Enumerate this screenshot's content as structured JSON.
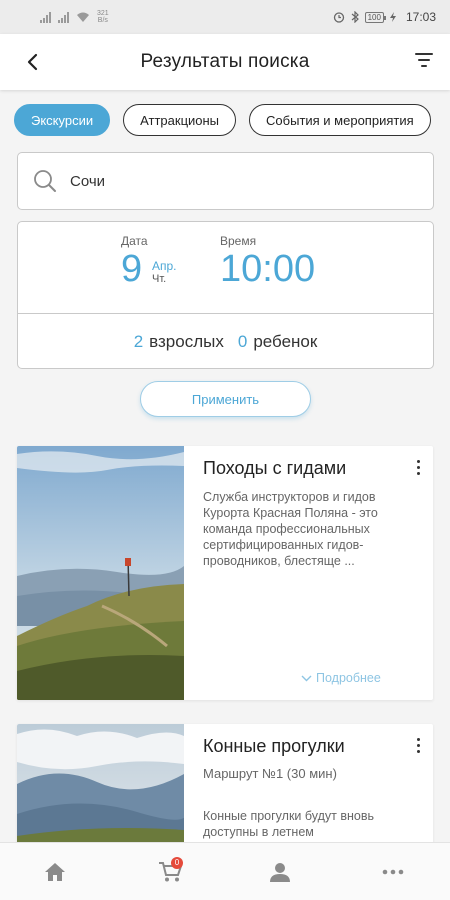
{
  "status_bar": {
    "net_speed_value": "321",
    "net_speed_unit": "B/s",
    "battery": "100",
    "time": "17:03"
  },
  "header": {
    "title": "Результаты поиска",
    "back_icon": "back-arrow-icon",
    "filter_icon": "filter-icon"
  },
  "categories": [
    {
      "label": "Экскурсии",
      "active": true
    },
    {
      "label": "Аттракционы",
      "active": false
    },
    {
      "label": "События и мероприятия",
      "active": false
    }
  ],
  "search": {
    "value": "Сочи",
    "icon": "search-icon"
  },
  "date": {
    "label": "Дата",
    "day": "9",
    "month": "Апр.",
    "weekday": "Чт."
  },
  "time": {
    "label": "Время",
    "value": "10:00"
  },
  "guests": {
    "adults_count": "2",
    "adults_label": "взрослых",
    "children_count": "0",
    "children_label": "ребенок"
  },
  "apply_label": "Применить",
  "results": [
    {
      "title": "Походы с гидами",
      "description": "Служба инструкторов и гидов Курорта Красная Поляна - это команда профессиональных сертифицированных гидов-проводников, блестяще ...",
      "more_label": "Подробнее"
    },
    {
      "title": "Конные прогулки",
      "subtitle": "Маршрут №1 (30 мин)",
      "description": "Конные прогулки будут вновь доступны в летнем"
    }
  ],
  "bottom_nav": {
    "home_icon": "home-icon",
    "cart_icon": "cart-icon",
    "cart_badge": "0",
    "profile_icon": "profile-icon",
    "more_icon": "more-dots-icon"
  },
  "colors": {
    "accent": "#4ca7d6",
    "badge": "#e54a3b"
  }
}
